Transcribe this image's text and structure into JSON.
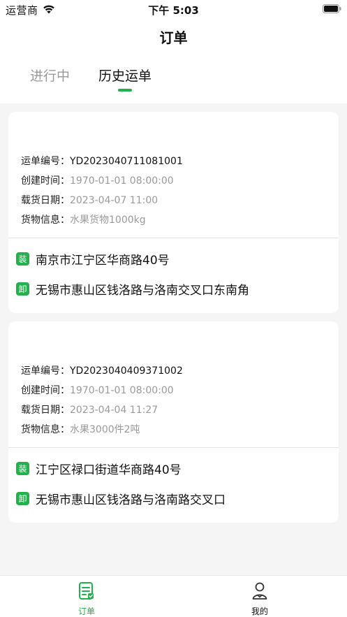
{
  "status_bar": {
    "carrier": "运营商",
    "time": "下午 5:03",
    "wifi_icon": "wifi-icon",
    "battery_icon": "battery-icon"
  },
  "nav": {
    "title": "订单"
  },
  "tabs": [
    {
      "label": "进行中",
      "active": false
    },
    {
      "label": "历史运单",
      "active": true
    }
  ],
  "labels": {
    "order_no": "运单编号：",
    "created_at": "创建时间：",
    "load_date": "载货日期：",
    "goods": "货物信息：",
    "load_badge": "装",
    "unload_badge": "卸"
  },
  "orders": [
    {
      "order_no": "YD2023040711081001",
      "created_at": "1970-01-01 08:00:00",
      "load_date": "2023-04-07 11:00",
      "goods": "水果货物1000kg",
      "load_address": "南京市江宁区华商路40号",
      "unload_address": "无锡市惠山区钱洛路与洛南交叉口东南角"
    },
    {
      "order_no": "YD2023040409371002",
      "created_at": "1970-01-01 08:00:00",
      "load_date": "2023-04-04 11:27",
      "goods": "水果3000件2吨",
      "load_address": "江宁区禄口街道华商路40号",
      "unload_address": "无锡市惠山区钱洛路与洛南路交叉口"
    }
  ],
  "tabbar": [
    {
      "label": "订单",
      "icon": "orders-icon",
      "active": true
    },
    {
      "label": "我的",
      "icon": "profile-icon",
      "active": false
    }
  ],
  "colors": {
    "accent": "#22b14c",
    "background": "#f5f5f5",
    "muted_text": "#9a9a9a"
  }
}
